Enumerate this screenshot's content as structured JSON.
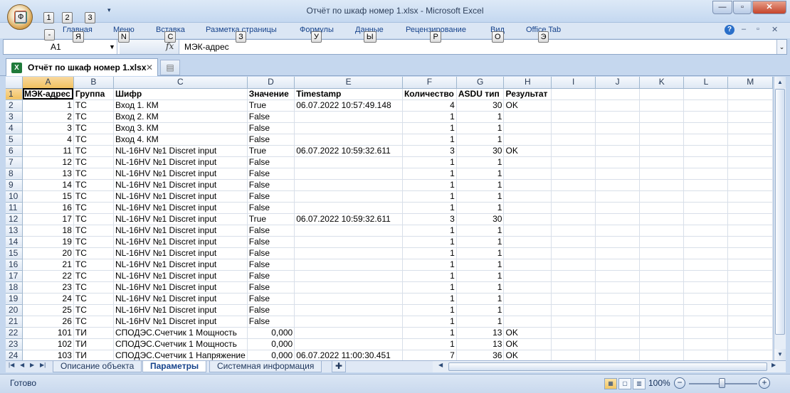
{
  "window": {
    "title": "Отчёт по шкаф номер 1.xlsx - Microsoft Excel"
  },
  "office_button": {
    "keytip": "Ф"
  },
  "qat_keytips": [
    "1",
    "2",
    "3"
  ],
  "ribbon_tabs": [
    {
      "label": "Главная",
      "keytip": "Я"
    },
    {
      "label": "Меню",
      "keytip": "N"
    },
    {
      "label": "Вставка",
      "keytip": "С"
    },
    {
      "label": "Разметка страницы",
      "keytip": "З"
    },
    {
      "label": "Формулы",
      "keytip": "У"
    },
    {
      "label": "Данные",
      "keytip": "Ы"
    },
    {
      "label": "Рецензирование",
      "keytip": "Р"
    },
    {
      "label": "Вид",
      "keytip": "О"
    },
    {
      "label": "Office Tab",
      "keytip": "Э"
    }
  ],
  "file_keytip": "-",
  "formula_bar": {
    "name_box": "A1",
    "fx_label": "fx",
    "content": "МЭК-адрес"
  },
  "document_tab": {
    "label": "Отчёт по шкаф номер 1.xlsx"
  },
  "columns": [
    "A",
    "B",
    "C",
    "D",
    "E",
    "F",
    "G",
    "H",
    "I",
    "J",
    "K",
    "L",
    "M"
  ],
  "rows": [
    {
      "n": "1",
      "cells": [
        "МЭК-адрес",
        "Группа",
        "Шифр",
        "Значение",
        "Timestamp",
        "Количество",
        "ASDU тип",
        "Результат"
      ]
    },
    {
      "n": "2",
      "cells": [
        "1",
        "ТС",
        "Вход 1. КМ",
        "True",
        "06.07.2022 10:57:49.148",
        "4",
        "30",
        "OK"
      ]
    },
    {
      "n": "3",
      "cells": [
        "2",
        "ТС",
        "Вход 2. КМ",
        "False",
        "",
        "1",
        "1",
        ""
      ]
    },
    {
      "n": "4",
      "cells": [
        "3",
        "ТС",
        "Вход 3. КМ",
        "False",
        "",
        "1",
        "1",
        ""
      ]
    },
    {
      "n": "5",
      "cells": [
        "4",
        "ТС",
        "Вход 4. КМ",
        "False",
        "",
        "1",
        "1",
        ""
      ]
    },
    {
      "n": "6",
      "cells": [
        "11",
        "ТС",
        "NL-16HV №1 Discret input",
        "True",
        "06.07.2022 10:59:32.611",
        "3",
        "30",
        "OK"
      ]
    },
    {
      "n": "7",
      "cells": [
        "12",
        "ТС",
        "NL-16HV №1 Discret input",
        "False",
        "",
        "1",
        "1",
        ""
      ]
    },
    {
      "n": "8",
      "cells": [
        "13",
        "ТС",
        "NL-16HV №1 Discret input",
        "False",
        "",
        "1",
        "1",
        ""
      ]
    },
    {
      "n": "9",
      "cells": [
        "14",
        "ТС",
        "NL-16HV №1 Discret input",
        "False",
        "",
        "1",
        "1",
        ""
      ]
    },
    {
      "n": "10",
      "cells": [
        "15",
        "ТС",
        "NL-16HV №1 Discret input",
        "False",
        "",
        "1",
        "1",
        ""
      ]
    },
    {
      "n": "11",
      "cells": [
        "16",
        "ТС",
        "NL-16HV №1 Discret input",
        "False",
        "",
        "1",
        "1",
        ""
      ]
    },
    {
      "n": "12",
      "cells": [
        "17",
        "ТС",
        "NL-16HV №1 Discret input",
        "True",
        "06.07.2022 10:59:32.611",
        "3",
        "30",
        ""
      ]
    },
    {
      "n": "13",
      "cells": [
        "18",
        "ТС",
        "NL-16HV №1 Discret input",
        "False",
        "",
        "1",
        "1",
        ""
      ]
    },
    {
      "n": "14",
      "cells": [
        "19",
        "ТС",
        "NL-16HV №1 Discret input",
        "False",
        "",
        "1",
        "1",
        ""
      ]
    },
    {
      "n": "15",
      "cells": [
        "20",
        "ТС",
        "NL-16HV №1 Discret input",
        "False",
        "",
        "1",
        "1",
        ""
      ]
    },
    {
      "n": "16",
      "cells": [
        "21",
        "ТС",
        "NL-16HV №1 Discret input",
        "False",
        "",
        "1",
        "1",
        ""
      ]
    },
    {
      "n": "17",
      "cells": [
        "22",
        "ТС",
        "NL-16HV №1 Discret input",
        "False",
        "",
        "1",
        "1",
        ""
      ]
    },
    {
      "n": "18",
      "cells": [
        "23",
        "ТС",
        "NL-16HV №1 Discret input",
        "False",
        "",
        "1",
        "1",
        ""
      ]
    },
    {
      "n": "19",
      "cells": [
        "24",
        "ТС",
        "NL-16HV №1 Discret input",
        "False",
        "",
        "1",
        "1",
        ""
      ]
    },
    {
      "n": "20",
      "cells": [
        "25",
        "ТС",
        "NL-16HV №1 Discret input",
        "False",
        "",
        "1",
        "1",
        ""
      ]
    },
    {
      "n": "21",
      "cells": [
        "26",
        "ТС",
        "NL-16HV №1 Discret input",
        "False",
        "",
        "1",
        "1",
        ""
      ]
    },
    {
      "n": "22",
      "cells": [
        "101",
        "ТИ",
        "СПОДЭС.Счетчик 1 Мощность",
        "0,000",
        "",
        "1",
        "13",
        "OK"
      ]
    },
    {
      "n": "23",
      "cells": [
        "102",
        "ТИ",
        "СПОДЭС.Счетчик 1 Мощность",
        "0,000",
        "",
        "1",
        "13",
        "OK"
      ]
    },
    {
      "n": "24",
      "cells": [
        "103",
        "ТИ",
        "СПОДЭС.Счетчик 1 Напряжение",
        "0,000",
        "06.07.2022 11:00:30.451",
        "7",
        "36",
        "OK"
      ]
    }
  ],
  "sheets": [
    {
      "label": "Описание объекта"
    },
    {
      "label": "Параметры"
    },
    {
      "label": "Системная информация"
    }
  ],
  "status": {
    "text": "Готово",
    "zoom": "100%"
  }
}
